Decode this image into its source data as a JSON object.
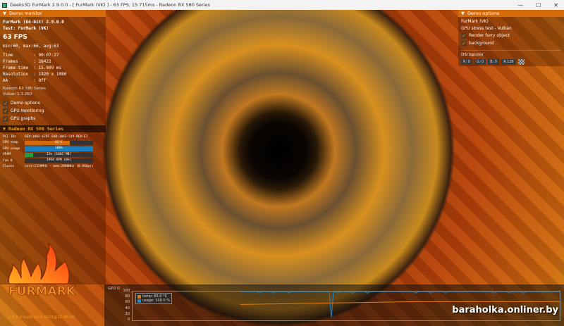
{
  "window": {
    "title": "Geeks3D FurMark 2.9.0.0 - [ FurMark (VK) ] - 63 FPS, 15.715ms - Radeon RX 580 Series",
    "controls": [
      "—",
      "☐",
      "✕"
    ]
  },
  "monitor": {
    "header": "Demo monitor",
    "app": "FurMark (64-bit) 2.9.0.0",
    "test": "Test: FurMark (VK)",
    "fps": "63 FPS",
    "stats": "min:60, max:66, avg:63",
    "rows": [
      "Time        : 00:07:27",
      "Frames      : 28422",
      "Frame time  : 15.909 ms",
      "Resolution  : 1920 x 1080",
      "AA          : Off"
    ],
    "gpu": "Radeon RX 580 Series",
    "api": "Vulkan 1.3.260",
    "checks": [
      {
        "label": "Demo options",
        "checked": true
      },
      {
        "label": "GPU monitoring",
        "checked": true
      },
      {
        "label": "GPU graphs",
        "checked": true
      }
    ]
  },
  "gpu_panel": {
    "header": "Radeon RX 580 Series",
    "pci_label": "PCI IDs",
    "pci": "DEV:1002-67DF SUB:1043-519 REV:E7",
    "bars": [
      {
        "label": "GPU temp",
        "text": "65°C",
        "percent": 66,
        "color": "#d46a08"
      },
      {
        "label": "GPU usage",
        "text": "100%",
        "percent": 100,
        "color": "#1a80c0"
      },
      {
        "label": "VRAM",
        "text": "12% (1002 MB)",
        "percent": 12,
        "color": "#2a9a40"
      },
      {
        "label": "Fan 0",
        "text": "1994 RPM (0%)",
        "percent": 0,
        "color": "#888"
      }
    ],
    "clocks_label": "Clocks",
    "clocks": "core:1320MHz - mem:2000MHz (8.0Gbps)"
  },
  "options": {
    "header": "Demo options",
    "title": "FurMark (VK)",
    "subtitle": "GPU stress test - Vulkan",
    "checks": [
      {
        "label": "Render furry object",
        "checked": true
      },
      {
        "label": "background",
        "checked": true
      }
    ],
    "osi_label": "OSI bgcolor",
    "color": [
      "R: 0",
      "G: 0",
      "B: 0",
      "A:128"
    ]
  },
  "logo": {
    "text": "FURMARK",
    "build": "2.9.0.0 build Jul  4 2025@11:45:20"
  },
  "graph": {
    "title": "GPU 0",
    "yticks": [
      "100",
      "80",
      "60",
      "40",
      "20",
      "0"
    ],
    "legend": [
      {
        "label": "temp: 65.0 °C",
        "color": "#e07a10"
      },
      {
        "label": "usage: 100.0 %",
        "color": "#1a88d0"
      }
    ]
  },
  "watermark": "baraholka.onliner.by"
}
